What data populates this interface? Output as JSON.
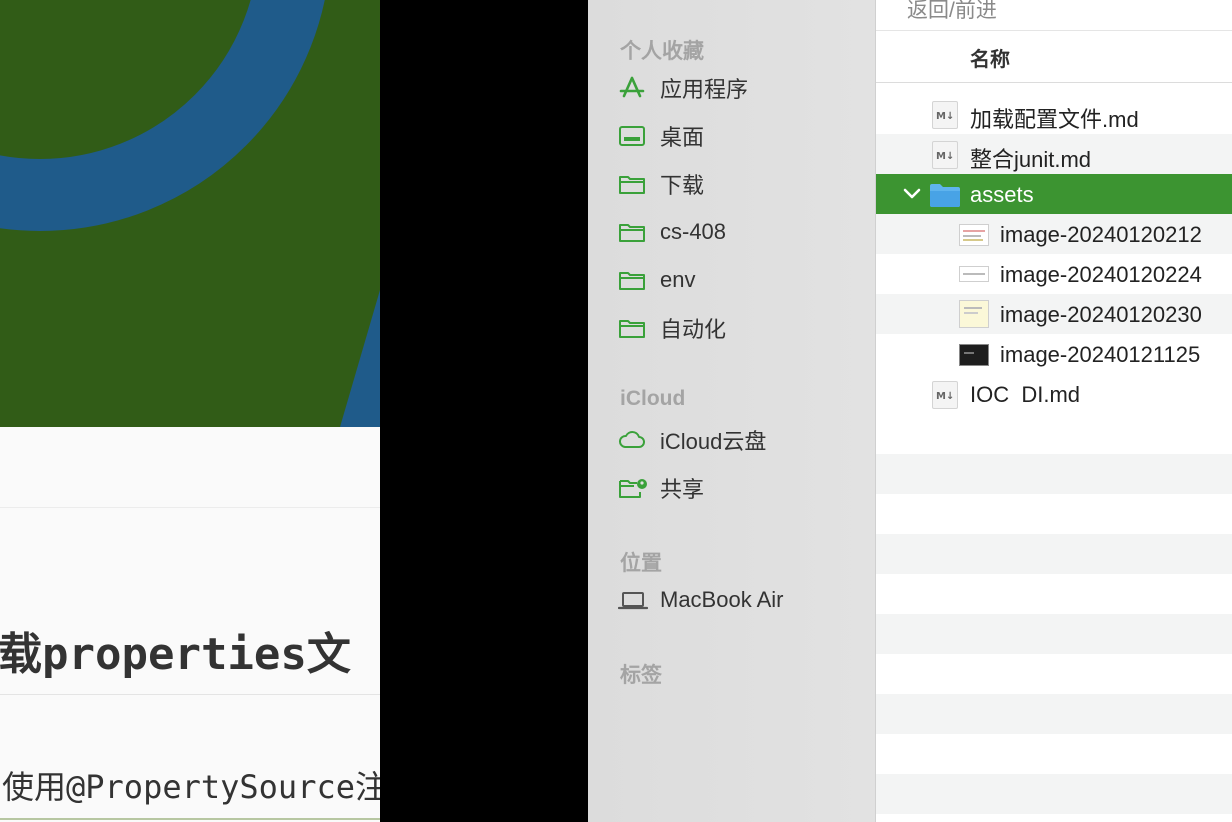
{
  "document": {
    "heading": "载properties文",
    "paragraph": "使用@PropertySource注"
  },
  "sidebar": {
    "favorites_title": "个人收藏",
    "favorites": [
      {
        "label": "应用程序",
        "icon": "applications-icon"
      },
      {
        "label": "桌面",
        "icon": "desktop-icon"
      },
      {
        "label": "下载",
        "icon": "folder-icon"
      },
      {
        "label": "cs-408",
        "icon": "folder-icon"
      },
      {
        "label": "env",
        "icon": "folder-icon"
      },
      {
        "label": "自动化",
        "icon": "folder-icon"
      }
    ],
    "icloud_title": "iCloud",
    "icloud": [
      {
        "label": "iCloud云盘",
        "icon": "cloud-icon"
      },
      {
        "label": "共享",
        "icon": "shared-folder-icon"
      }
    ],
    "locations_title": "位置",
    "locations": [
      {
        "label": "MacBook Air",
        "icon": "laptop-icon"
      }
    ],
    "tags_title": "标签"
  },
  "filelist": {
    "back_forward": "返回/前进",
    "column_name": "名称",
    "rows": [
      {
        "name": "加载配置文件.md",
        "type": "markdown"
      },
      {
        "name": "整合junit.md",
        "type": "markdown"
      },
      {
        "name": "assets",
        "type": "folder",
        "expanded": true,
        "selected": true
      },
      {
        "name": "image-20240120212",
        "type": "image"
      },
      {
        "name": "image-20240120224",
        "type": "image"
      },
      {
        "name": "image-20240120230",
        "type": "image"
      },
      {
        "name": "image-20240121125",
        "type": "image"
      },
      {
        "name": "IOC  DI.md",
        "type": "markdown"
      }
    ]
  },
  "colors": {
    "accent": "#3c9431",
    "sidebar_icon": "#3aa13a",
    "image_background": "#315c17",
    "image_ring": "#1f5b8a"
  }
}
